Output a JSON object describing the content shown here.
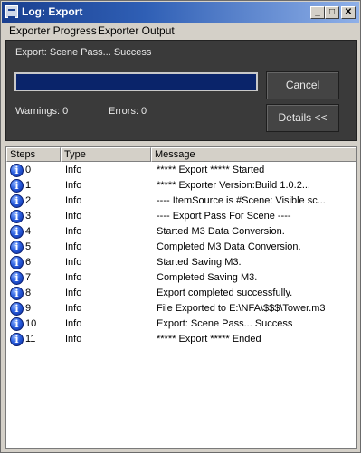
{
  "window": {
    "title": "Log: Export"
  },
  "titlebar_buttons": {
    "minimize": "_",
    "maximize": "□",
    "close": "✕"
  },
  "menu": [
    "Exporter Progress",
    "Exporter Output"
  ],
  "panel": {
    "status": "Export: Scene Pass... Success",
    "progress_fraction": 1.0,
    "cancel_label": "Cancel",
    "warnings": "Warnings: 0",
    "errors": "Errors: 0",
    "details_label": "Details <<"
  },
  "log": {
    "columns": [
      "Steps",
      "Type",
      "Message"
    ],
    "rows": [
      {
        "step": "0",
        "type": "Info",
        "message": "*****   Export   ***** Started"
      },
      {
        "step": "1",
        "type": "Info",
        "message": "*****   Exporter Version:Build 1.0.2..."
      },
      {
        "step": "2",
        "type": "Info",
        "message": "---- ItemSource is #Scene: Visible sc..."
      },
      {
        "step": "3",
        "type": "Info",
        "message": "---- Export Pass For Scene ----"
      },
      {
        "step": "4",
        "type": "Info",
        "message": "Started M3 Data Conversion."
      },
      {
        "step": "5",
        "type": "Info",
        "message": "Completed M3 Data Conversion."
      },
      {
        "step": "6",
        "type": "Info",
        "message": "Started Saving M3."
      },
      {
        "step": "7",
        "type": "Info",
        "message": "Completed Saving M3."
      },
      {
        "step": "8",
        "type": "Info",
        "message": "Export completed successfully."
      },
      {
        "step": "9",
        "type": "Info",
        "message": "File Exported to E:\\NFA\\$$$\\Tower.m3"
      },
      {
        "step": "10",
        "type": "Info",
        "message": "Export: Scene Pass... Success"
      },
      {
        "step": "11",
        "type": "Info",
        "message": "*****   Export   ***** Ended"
      }
    ],
    "icon": "info-icon",
    "icon_glyph": "i"
  },
  "colors": {
    "titlebar": "#1a3f8f",
    "progress": "#0a246a",
    "panel": "#3a3a3a"
  }
}
